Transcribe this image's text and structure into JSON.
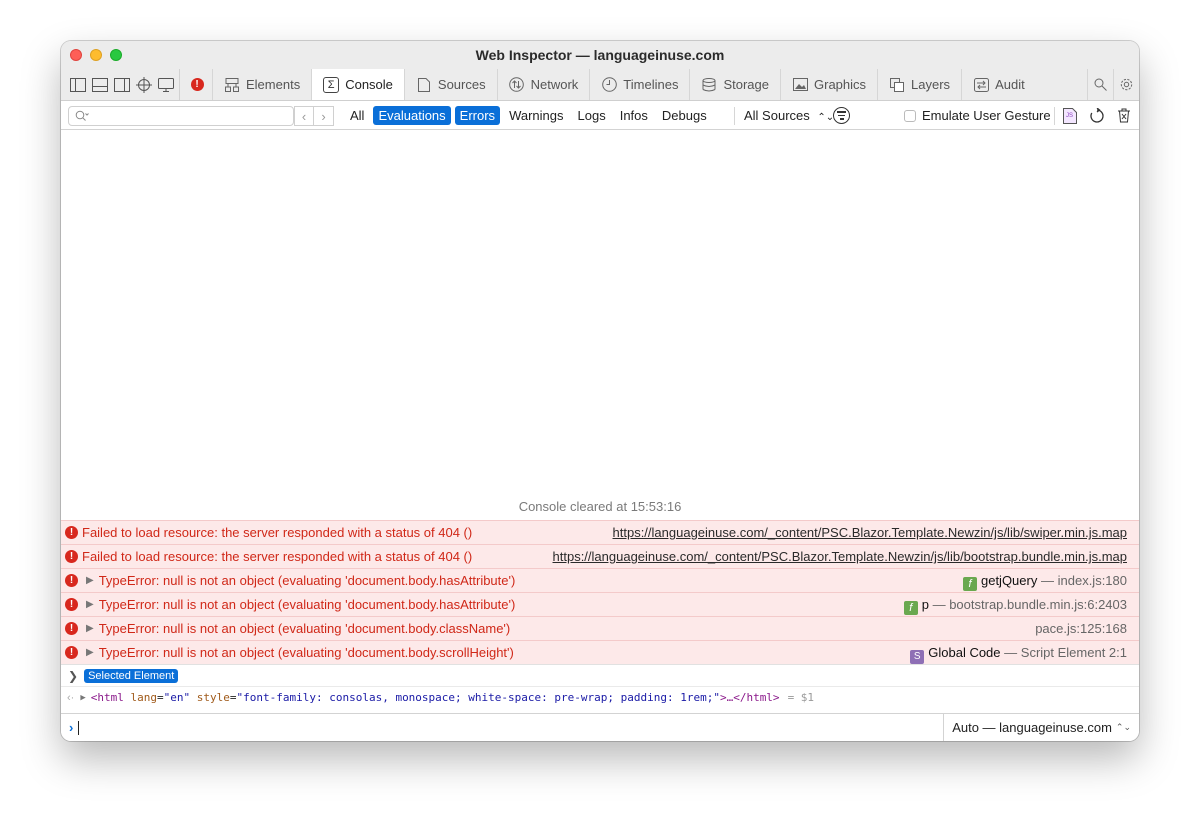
{
  "window": {
    "title": "Web Inspector — languageinuse.com"
  },
  "tabs": [
    {
      "label": "Elements",
      "icon": "elements-icon"
    },
    {
      "label": "Console",
      "icon": "console-icon",
      "active": true
    },
    {
      "label": "Sources",
      "icon": "sources-icon"
    },
    {
      "label": "Network",
      "icon": "network-icon"
    },
    {
      "label": "Timelines",
      "icon": "timelines-icon"
    },
    {
      "label": "Storage",
      "icon": "storage-icon"
    },
    {
      "label": "Graphics",
      "icon": "graphics-icon"
    },
    {
      "label": "Layers",
      "icon": "layers-icon"
    },
    {
      "label": "Audit",
      "icon": "audit-icon"
    }
  ],
  "filterbar": {
    "search_placeholder": "",
    "filters": [
      "All",
      "Evaluations",
      "Errors",
      "Warnings",
      "Logs",
      "Infos",
      "Debugs"
    ],
    "active_filters": [
      "Evaluations",
      "Errors"
    ],
    "sources_label": "All Sources",
    "emulate_label": "Emulate User Gesture"
  },
  "console": {
    "cleared_text": "Console cleared at 15:53:16",
    "messages": [
      {
        "text": "Failed to load resource: the server responded with a status of 404 ()",
        "location": "https://languageinuse.com/_content/PSC.Blazor.Template.Newzin/js/lib/swiper.min.js.map"
      },
      {
        "text": "Failed to load resource: the server responded with a status of 404 ()",
        "location": "https://languageinuse.com/_content/PSC.Blazor.Template.Newzin/js/lib/bootstrap.bundle.min.js.map"
      },
      {
        "text": "TypeError: null is not an object (evaluating 'document.body.hasAttribute')",
        "fn_badge": "f",
        "fn": "getjQuery",
        "location": "index.js:180"
      },
      {
        "text": "TypeError: null is not an object (evaluating 'document.body.hasAttribute')",
        "fn_badge": "f",
        "fn": "p",
        "location": "bootstrap.bundle.min.js:6:2403"
      },
      {
        "text": "TypeError: null is not an object (evaluating 'document.body.className')",
        "location": "pace.js:125:168"
      },
      {
        "text": "TypeError: null is not an object (evaluating 'document.body.scrollHeight')",
        "fn_badge": "S",
        "fn": "Global Code",
        "location": "Script Element 2:1"
      }
    ],
    "separator": "—",
    "selected_element_label": "Selected Element",
    "html_result": {
      "tag_open": "<html",
      "attr1": "lang",
      "val1": "\"en\"",
      "attr2": "style",
      "val2": "\"font-family: consolas, monospace; white-space: pre-wrap; padding: 1rem;\"",
      "tag_close": ">…</html>",
      "result_var": "= $1"
    },
    "context_label": "Auto — languageinuse.com"
  }
}
